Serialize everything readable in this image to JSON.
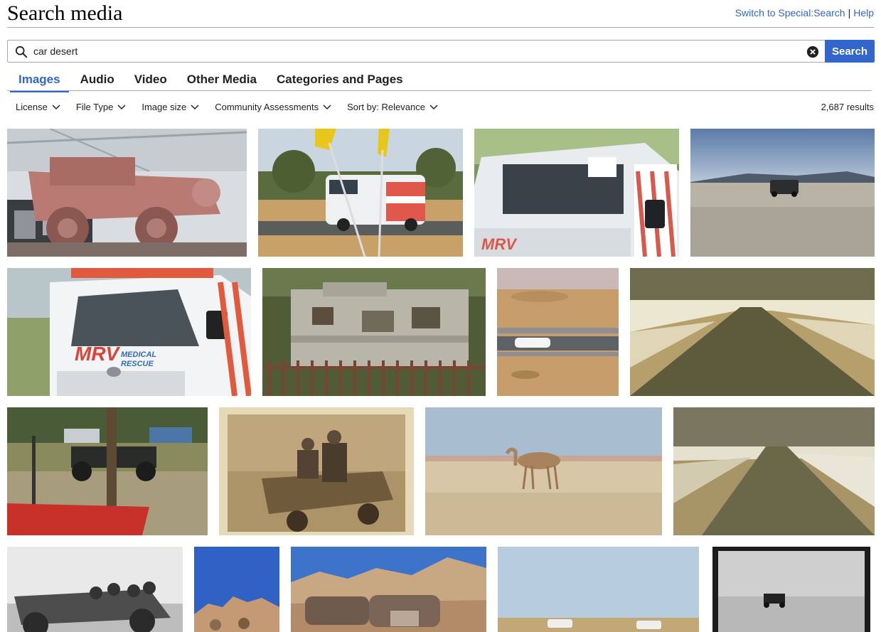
{
  "page": {
    "title": "Search media",
    "switch_link": "Switch to Special:Search",
    "separator": "|",
    "help_link": "Help"
  },
  "search": {
    "value": "car desert",
    "button_label": "Search"
  },
  "tabs": [
    {
      "label": "Images",
      "active": true
    },
    {
      "label": "Audio",
      "active": false
    },
    {
      "label": "Video",
      "active": false
    },
    {
      "label": "Other Media",
      "active": false
    },
    {
      "label": "Categories and Pages",
      "active": false
    }
  ],
  "filters": [
    {
      "label": "License"
    },
    {
      "label": "File Type"
    },
    {
      "label": "Image size"
    },
    {
      "label": "Community Assessments"
    },
    {
      "label": "Sort by: Relevance"
    }
  ],
  "results_count": "2,687 results",
  "icons": {
    "search": "search-icon",
    "clear": "clear-icon",
    "dropdown": "chevron-down-icon"
  },
  "colors": {
    "accent": "#3366cc",
    "text": "#202122",
    "border": "#a2a9b1"
  },
  "images": [
    {
      "subject": "pink-land-rover"
    },
    {
      "subject": "mrv-van-with-flags"
    },
    {
      "subject": "white-vehicle-closeup"
    },
    {
      "subject": "suv-on-desert-plain"
    },
    {
      "subject": "mrv-medical-rescue-van"
    },
    {
      "subject": "old-caravan-trailer"
    },
    {
      "subject": "car-on-desert-road"
    },
    {
      "subject": "desert-road-sepia"
    },
    {
      "subject": "jeep-in-campsite"
    },
    {
      "subject": "vintage-photo-men-on-vehicle"
    },
    {
      "subject": "camel-in-desert"
    },
    {
      "subject": "desert-road-white-edges"
    },
    {
      "subject": "vintage-car-bw"
    },
    {
      "subject": "rocks-and-blue-sky"
    },
    {
      "subject": "rusty-car-in-rocks"
    },
    {
      "subject": "cars-on-desert-plain"
    },
    {
      "subject": "old-car-bw-plate"
    }
  ]
}
